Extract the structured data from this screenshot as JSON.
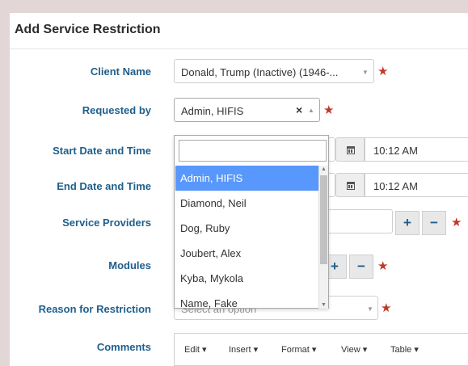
{
  "title": "Add Service Restriction",
  "form": {
    "client_name": {
      "label": "Client Name",
      "value": "Donald, Trump (Inactive) (1946-..."
    },
    "requested_by": {
      "label": "Requested by",
      "value": "Admin, HIFIS",
      "clear": "×"
    },
    "start": {
      "label": "Start Date and Time",
      "time": "10:12 AM"
    },
    "end": {
      "label": "End Date and Time",
      "time": "10:12 AM"
    },
    "service_providers": {
      "label": "Service Providers",
      "add": "+",
      "remove": "−"
    },
    "modules": {
      "label": "Modules",
      "add": "+",
      "remove": "−"
    },
    "reason": {
      "label": "Reason for Restriction",
      "placeholder": "Select an option"
    },
    "comments": {
      "label": "Comments"
    },
    "required_mark": "★"
  },
  "dropdown": {
    "items": [
      "Admin, HIFIS",
      "Diamond, Neil",
      "Dog, Ruby",
      "Joubert, Alex",
      "Kyba, Mykola",
      "Name, Fake"
    ],
    "highlighted_index": 0
  },
  "editor_menu": [
    "Edit ▾",
    "Insert ▾",
    "Format ▾",
    "View ▾",
    "Table ▾"
  ],
  "icons": {
    "calendar": "calendar-icon",
    "caret": "caret-down-icon"
  },
  "colors": {
    "label": "#1f5f8b",
    "required": "#c0392b",
    "highlight": "#5897fb"
  }
}
